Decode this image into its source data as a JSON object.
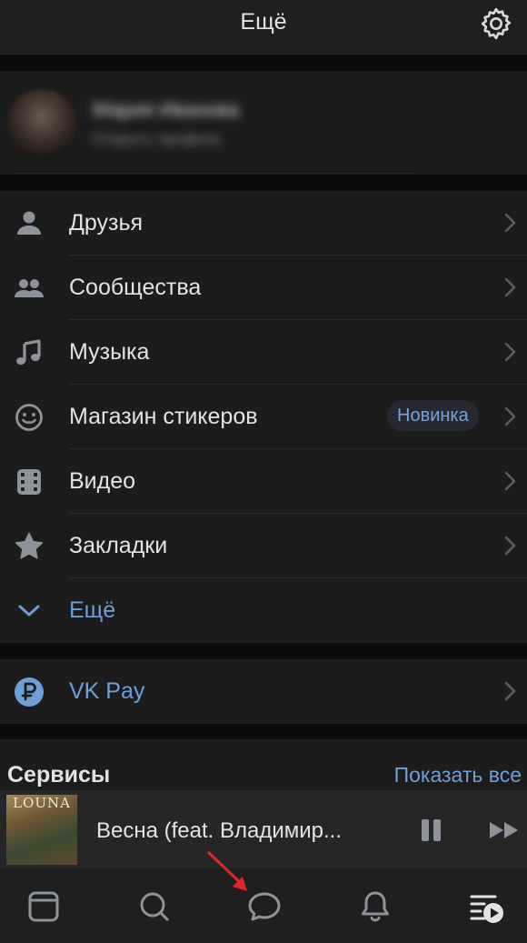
{
  "header": {
    "title": "Ещё"
  },
  "profile": {
    "name": "Мария Иванова",
    "subtitle": "Открыть профиль"
  },
  "menu": {
    "items": [
      {
        "label": "Друзья",
        "icon": "person-icon"
      },
      {
        "label": "Сообщества",
        "icon": "people-icon"
      },
      {
        "label": "Музыка",
        "icon": "music-note-icon"
      },
      {
        "label": "Магазин стикеров",
        "icon": "smile-icon",
        "badge": "Новинка"
      },
      {
        "label": "Видео",
        "icon": "video-icon"
      },
      {
        "label": "Закладки",
        "icon": "star-icon"
      }
    ],
    "more_label": "Ещё"
  },
  "pay": {
    "label": "VK Pay",
    "icon": "ruble-icon"
  },
  "services": {
    "title": "Сервисы",
    "show_all": "Показать все"
  },
  "player": {
    "track": "Весна (feat. Владимир...",
    "cover_artist": "LOUNA"
  },
  "tabs": [
    "news-tab",
    "search-tab",
    "messages-tab",
    "notifications-tab",
    "menu-tab"
  ],
  "colors": {
    "accent": "#6f9fd8",
    "background": "#0c0c0c",
    "surface": "#1c1c1c",
    "icon": "#8e9399",
    "annotation_arrow": "#e0262b"
  }
}
